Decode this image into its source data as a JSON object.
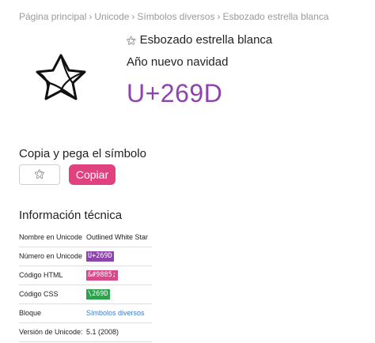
{
  "breadcrumb": {
    "items": [
      "Página principal",
      "Unicode",
      "Símbolos diversos",
      "Esbozado estrella blanca"
    ],
    "separator": "›"
  },
  "symbol": {
    "glyph": "⚝",
    "name": "Esbozado estrella blanca",
    "subtitle": "Año nuevo navidad",
    "code": "U+269D",
    "code_color": "#8e44ad"
  },
  "copy": {
    "heading": "Copia y pega el símbolo",
    "field_value": "⚝",
    "button_label": "Copiar",
    "button_color": "#e0427f"
  },
  "tech": {
    "heading": "Información técnica",
    "rows": [
      {
        "key": "Nombre en Unicode",
        "value": "Outlined White Star"
      },
      {
        "key": "Número en Unicode",
        "value": "U+269D"
      },
      {
        "key": "Código HTML",
        "value": "&#9885;"
      },
      {
        "key": "Código CSS",
        "value": "\\269D"
      },
      {
        "key": "Bloque",
        "value": "Símbolos diversos"
      },
      {
        "key": "Versión de Unicode:",
        "value": "5.1 (2008)"
      }
    ]
  }
}
